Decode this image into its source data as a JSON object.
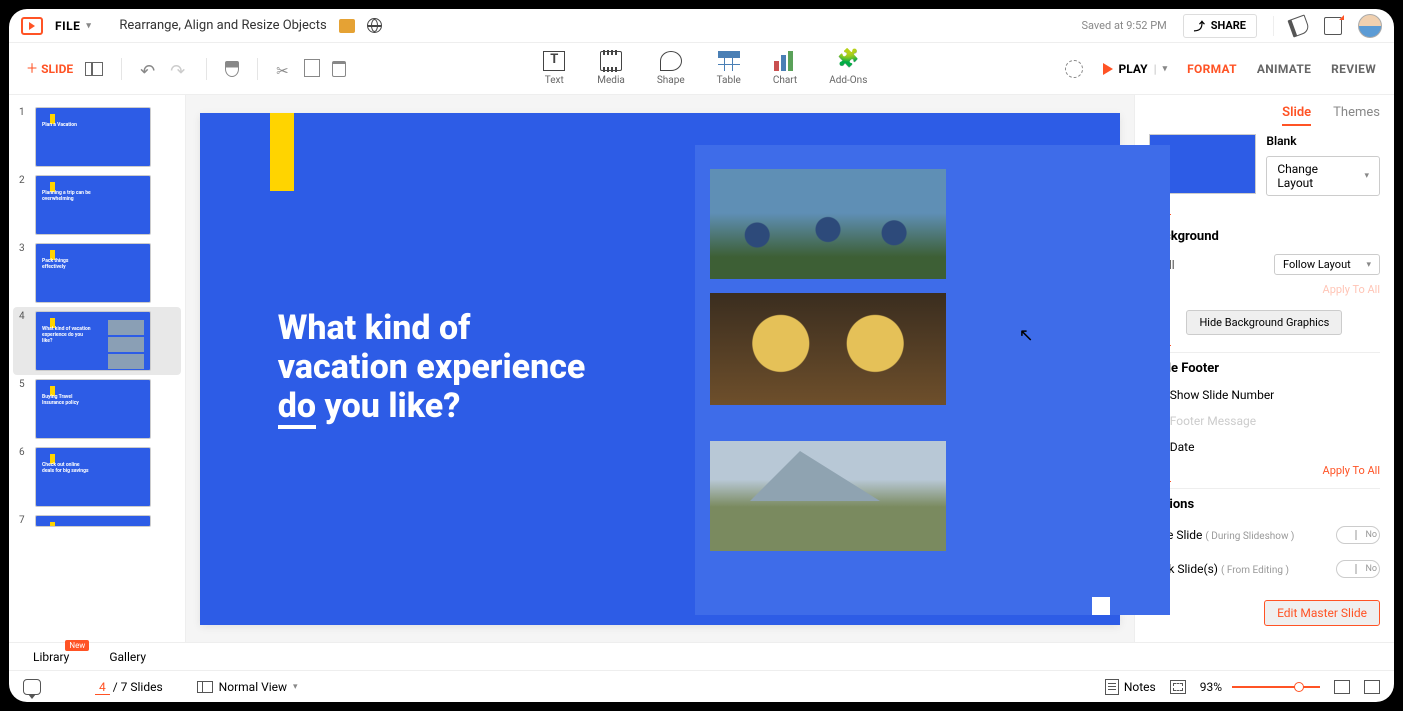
{
  "topbar": {
    "file_label": "FILE",
    "doc_title": "Rearrange, Align and Resize Objects",
    "saved_text": "Saved at 9:52 PM",
    "share_label": "SHARE"
  },
  "toolbar": {
    "add_slide_label": "SLIDE"
  },
  "insert": {
    "text": "Text",
    "media": "Media",
    "shape": "Shape",
    "table": "Table",
    "chart": "Chart",
    "addons": "Add-Ons"
  },
  "playbar": {
    "play": "PLAY",
    "format": "FORMAT",
    "animate": "ANIMATE",
    "review": "REVIEW"
  },
  "thumbs": [
    {
      "n": "1",
      "title": "Plan a Vacation"
    },
    {
      "n": "2",
      "title": "Planning a trip can be overwhelming"
    },
    {
      "n": "3",
      "title": "Pack things effectively"
    },
    {
      "n": "4",
      "title": "What kind of vacation experience do you like?"
    },
    {
      "n": "5",
      "title": "Buying Travel Insurance policy"
    },
    {
      "n": "6",
      "title": "Check out online deals for big savings"
    },
    {
      "n": "7",
      "title": ""
    }
  ],
  "slide": {
    "heading_l1": "What kind of",
    "heading_l2": "vacation experience",
    "heading_l3": "do you like?"
  },
  "rpanel": {
    "tab_slide": "Slide",
    "tab_themes": "Themes",
    "layout_name": "Blank",
    "change_layout": "Change Layout",
    "background": "Background",
    "fill_label": "Fill",
    "fill_value": "Follow Layout",
    "apply_all": "Apply To All",
    "hide_bg": "Hide Background Graphics",
    "slide_footer": "Slide Footer",
    "show_slide_no": "Show Slide Number",
    "footer_msg": "Footer Message",
    "date": "Date",
    "options": "Options",
    "hide_slide": "Hide Slide",
    "hide_slide_sub": "( During Slideshow )",
    "lock_slides": "Lock Slide(s)",
    "lock_slides_sub": "( From Editing )",
    "toggle_no": "No",
    "edit_master": "Edit Master Slide"
  },
  "lib": {
    "library": "Library",
    "gallery": "Gallery",
    "new_badge": "New"
  },
  "status": {
    "current_slide": "4",
    "total_slides_label": "/ 7 Slides",
    "view_label": "Normal View",
    "notes_label": "Notes",
    "zoom": "93%"
  }
}
